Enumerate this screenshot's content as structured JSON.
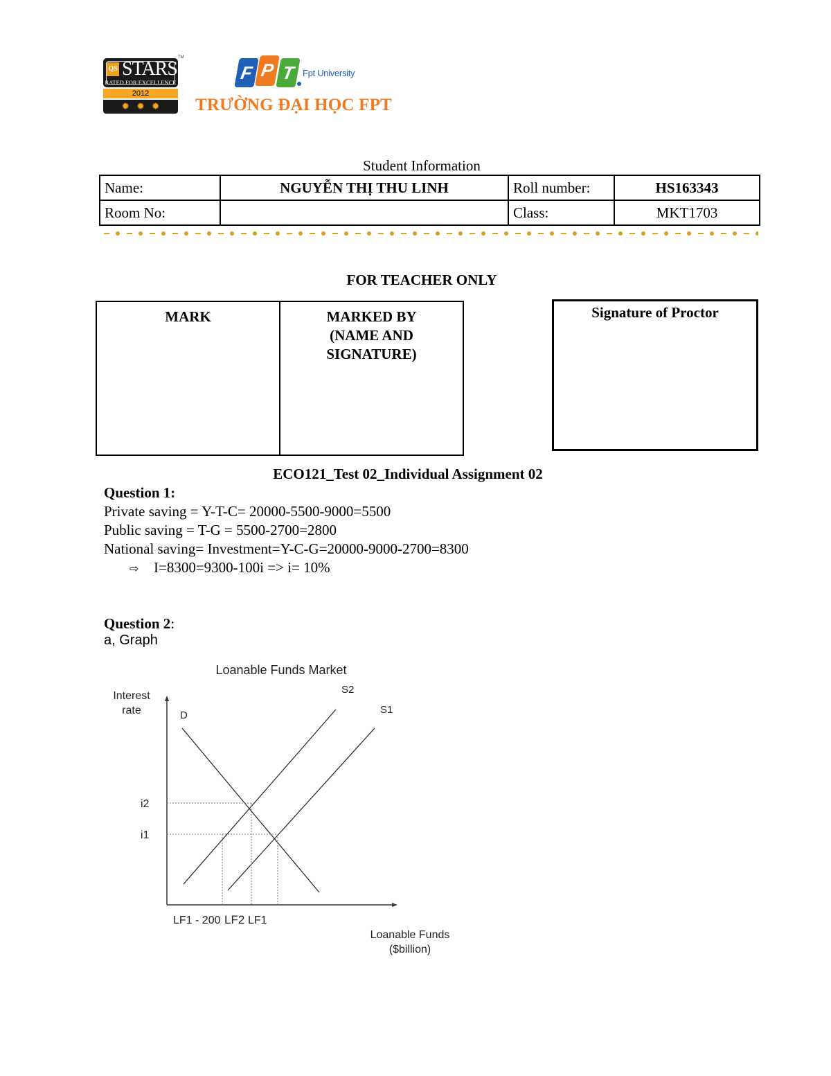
{
  "header": {
    "qs_logo": {
      "badge": "QS",
      "title": "STARS",
      "subtitle": "RATED FOR EXCELLENCE",
      "year": "2012",
      "tm": "TM",
      "star_count": 3
    },
    "fpt_logo": {
      "letters": [
        "F",
        "P",
        "T"
      ],
      "university": "Fpt University",
      "school_name": "TRƯỜNG ĐẠI HỌC FPT",
      "colors": {
        "blue": "#1f5fb4",
        "orange": "#f07a22",
        "green": "#4aaa3a"
      }
    }
  },
  "student_info": {
    "title": "Student Information",
    "rows": [
      {
        "label1": "Name:",
        "value1": "NGUYỄN THỊ THU LINH",
        "label2": "Roll number:",
        "value2": "HS163343"
      },
      {
        "label1": "Room No:",
        "value1": "",
        "label2": "Class:",
        "value2": "MKT1703"
      }
    ],
    "separator_color": "#d9a21b"
  },
  "teacher": {
    "title": "FOR TEACHER ONLY",
    "mark_label": "MARK",
    "marked_by_lines": [
      "MARKED BY",
      "(NAME AND",
      "SIGNATURE)"
    ],
    "proctor_label": "Signature of Proctor"
  },
  "assignment": {
    "title": "ECO121_Test 02_Individual Assignment 02",
    "question1": {
      "heading": "Question 1:",
      "lines": [
        "Private saving = Y-T-C= 20000-5500-9000=5500",
        "Public saving = T-G = 5500-2700=2800",
        "National saving= Investment=Y-C-G=20000-9000-2700=8300"
      ],
      "conclusion_icon": "⇨",
      "conclusion": "I=8300=9300-100i => i= 10%"
    },
    "question2": {
      "heading": "Question 2",
      "heading_suffix": ":",
      "part_a": "a, Graph"
    }
  },
  "chart_data": {
    "type": "line",
    "title": "Loanable Funds Market",
    "title_color": "#1a1aee",
    "ylabel_lines": [
      "Interest",
      "rate"
    ],
    "xlabel_lines": [
      "Loanable Funds",
      "($billion)"
    ],
    "y_ticks": [
      "i2",
      "i1"
    ],
    "x_ticks": [
      "LF1 - 200",
      "LF2",
      "LF1"
    ],
    "axis_ranges_note": "conceptual, unitless",
    "xlim": [
      0,
      10
    ],
    "ylim": [
      0,
      10
    ],
    "series": [
      {
        "name": "D",
        "points": [
          [
            0.55,
            8.5
          ],
          [
            5.5,
            0.6
          ]
        ]
      },
      {
        "name": "S2",
        "points": [
          [
            0.6,
            1.0
          ],
          [
            6.1,
            9.4
          ]
        ]
      },
      {
        "name": "S1",
        "points": [
          [
            2.2,
            0.7
          ],
          [
            7.5,
            8.5
          ]
        ]
      }
    ],
    "equilibria": [
      {
        "label": "i1 / LF1",
        "x": 4.0,
        "y": 3.4,
        "on": [
          "D",
          "S1"
        ]
      },
      {
        "label": "i2 / LF2",
        "x": 3.05,
        "y": 4.9,
        "on": [
          "D",
          "S2"
        ]
      },
      {
        "label": "LF1 - 200",
        "x": 2.0,
        "y": 3.4,
        "on": [
          "S2"
        ]
      }
    ],
    "grid": false,
    "legend": "none (curve labels inline)"
  }
}
